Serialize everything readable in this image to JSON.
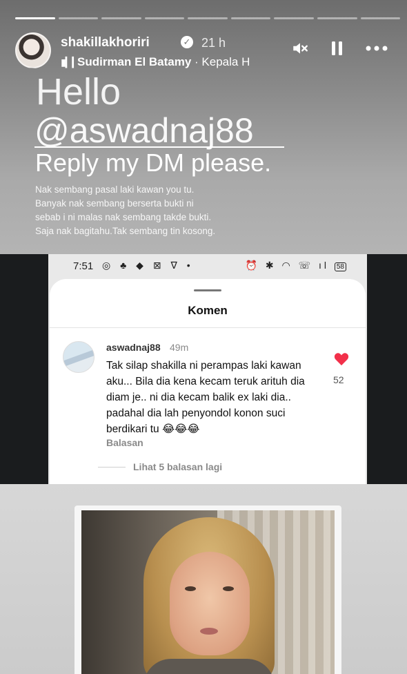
{
  "story": {
    "progress_segments": 9,
    "active_segment": 0,
    "username": "shakillakhoriri",
    "verified": true,
    "time_ago": "21 h",
    "music_title": "Sudirman El Batamy",
    "music_sub": " · Kepala H",
    "icons": {
      "verified": "verified-badge-icon",
      "music": "audio-wave-icon",
      "mute": "mute-icon",
      "pause": "pause-icon",
      "more": "more-icon"
    }
  },
  "overlay_text": {
    "hello": "Hello",
    "handle": "@aswadnaj88",
    "reply": "Reply my DM please.",
    "paragraph": [
      "Nak sembang pasal laki kawan you tu.",
      "Banyak nak sembang berserta bukti ni",
      "sebab i ni malas nak sembang takde bukti.",
      "Saja nak bagitahu.Tak sembang tin kosong."
    ]
  },
  "screenshot": {
    "status_time": "7:51",
    "battery": "58",
    "sheet_title": "Komen",
    "comment": {
      "user": "aswadnaj88",
      "time": "49m",
      "text": "Tak silap shakilla ni perampas laki kawan aku... Bila dia kena kecam teruk arituh dia diam je.. ni dia kecam balik ex laki dia.. padahal dia lah penyondol konon suci berdikari tu 😂😂😂",
      "reply_label": "Balasan",
      "likes": "52",
      "like_color": "#f2304a"
    },
    "more_replies": "Lihat 5 balasan lagi"
  },
  "colors": {
    "heart": "#f2304a",
    "top_gradient_start": "#6d6d6d",
    "top_gradient_end": "#b4b4b4"
  }
}
